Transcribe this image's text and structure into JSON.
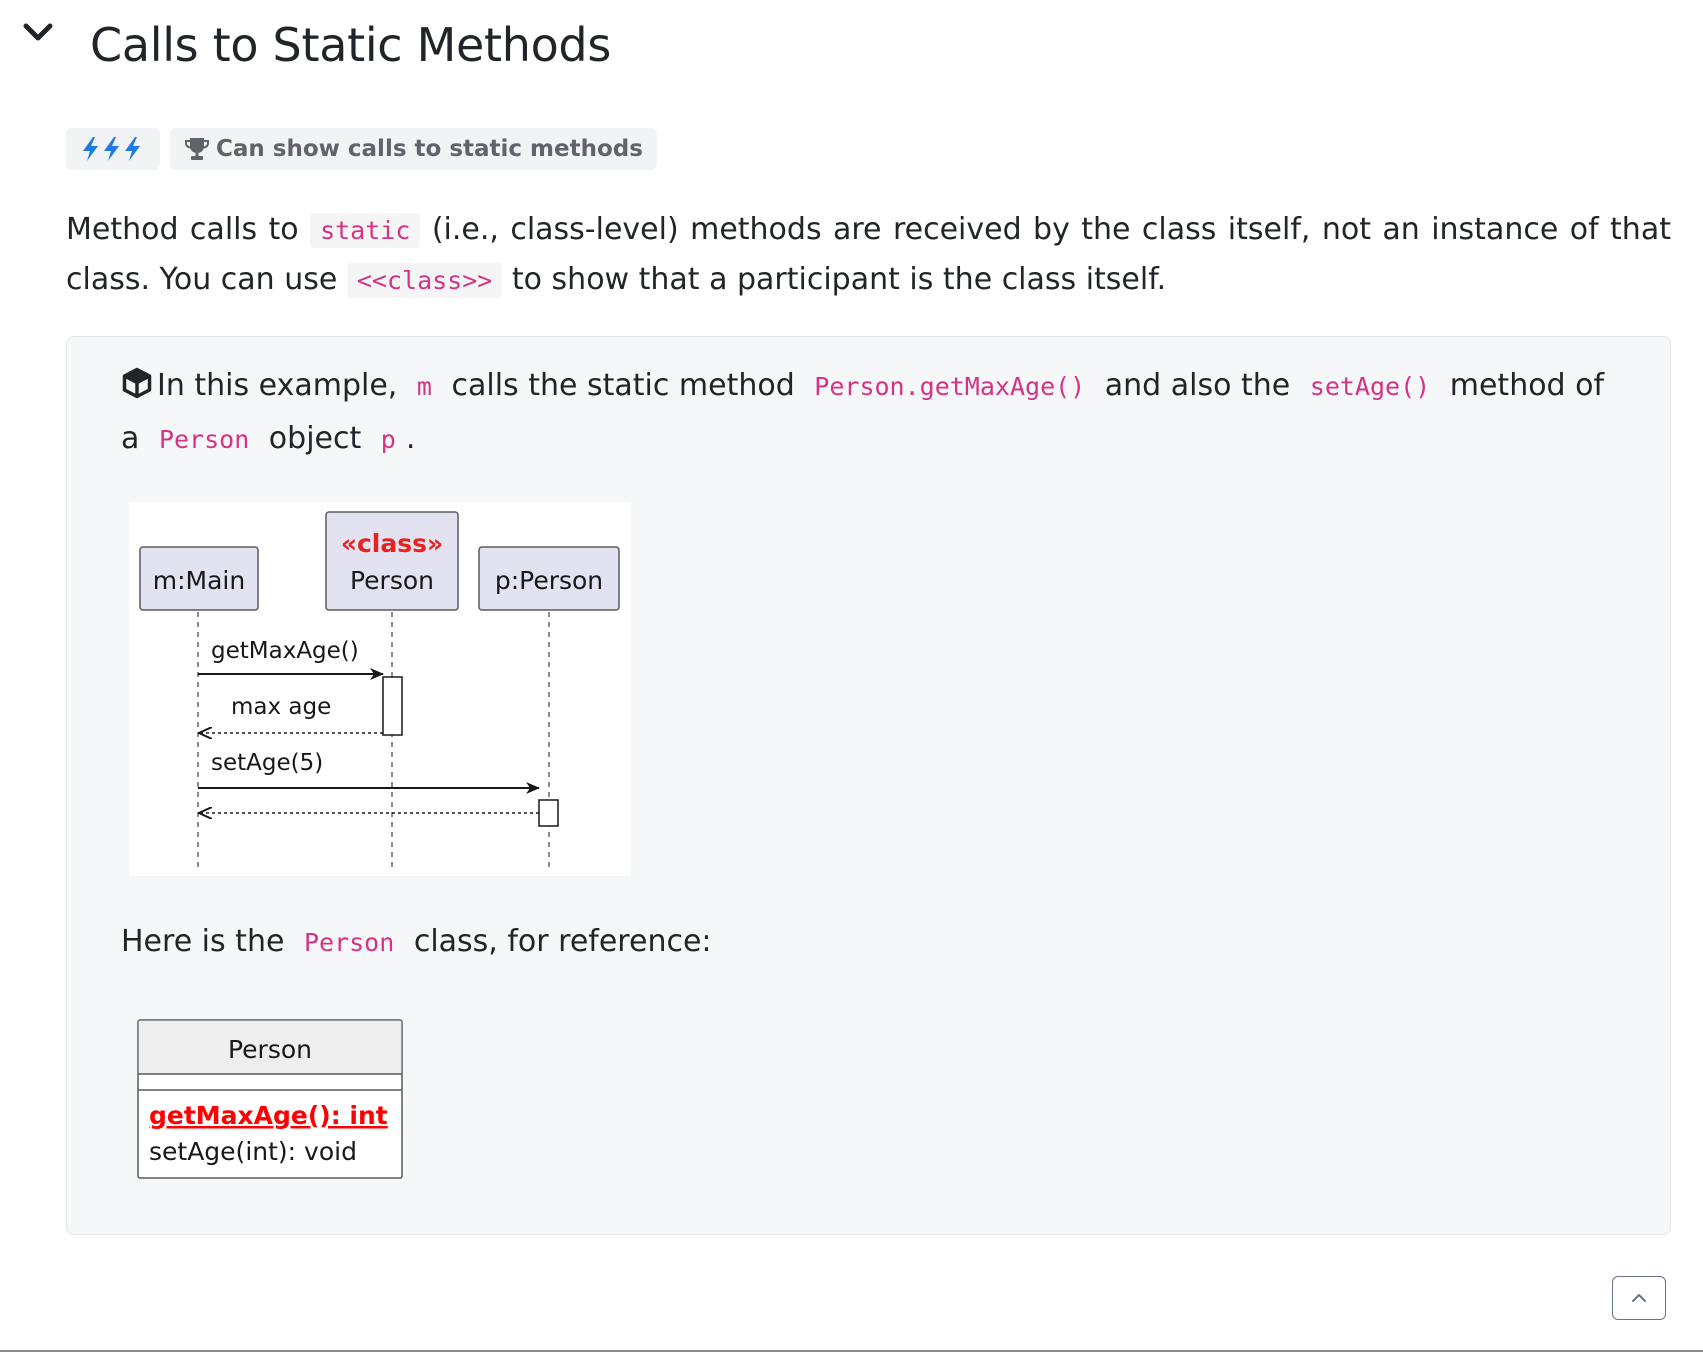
{
  "section": {
    "title": "Calls to Static Methods",
    "toggle_icon": "chevron-down-icon"
  },
  "badges": {
    "level_icon": "lightning-bolts-icon",
    "outcome_icon": "trophy-icon",
    "outcome": "Can show calls to static methods"
  },
  "intro": {
    "p1": "Method calls to",
    "code_static": "static",
    "p2": "(i.e., class-level) methods are received by the class itself, not an instance of that class. You can use",
    "code_class": "<<class>>",
    "p3": "to show that a participant is the class itself."
  },
  "example": {
    "icon": "box-icon",
    "p1": "In this example,",
    "code_m": "m",
    "p2": "calls the static method",
    "code_getmax": "Person.getMaxAge()",
    "p3": "and also the",
    "code_setage": "setAge()",
    "p4": "method of a",
    "code_person": "Person",
    "p5": "object",
    "code_p": "p",
    "p6": "."
  },
  "sequence_diagram": {
    "participant_main": "m:Main",
    "stereotype": "«class»",
    "participant_class": "Person",
    "participant_p": "p:Person",
    "msg_getmaxage": "getMaxAge()",
    "msg_maxage": "max age",
    "msg_setage": "setAge(5)",
    "colors": {
      "participant_fill": "#e2e2f0",
      "stereotype": "#e8231e"
    }
  },
  "reference": {
    "p1": "Here is the",
    "code_person": "Person",
    "p2": "class, for reference:"
  },
  "class_diagram": {
    "name": "Person",
    "static_method": "getMaxAge(): int",
    "method": "setAge(int): void",
    "colors": {
      "static_method": "#ff0000"
    }
  },
  "controls": {
    "back_to_top_icon": "chevron-up-icon"
  }
}
